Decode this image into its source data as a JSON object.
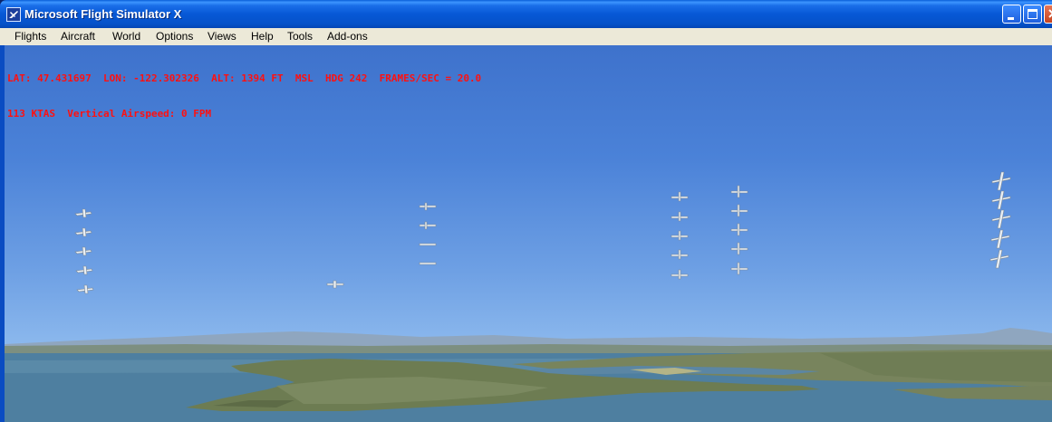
{
  "window": {
    "title": "Microsoft Flight Simulator X",
    "icon": "fsx-plane-icon",
    "controls": [
      "minimize",
      "maximize",
      "close"
    ]
  },
  "menubar": {
    "items": [
      {
        "label": "Flights"
      },
      {
        "label": "Aircraft"
      },
      {
        "label": "World"
      },
      {
        "label": "Options"
      },
      {
        "label": "Views"
      },
      {
        "label": "Help"
      },
      {
        "label": "Tools"
      },
      {
        "label": "Add-ons"
      }
    ]
  },
  "hud": {
    "line1": "LAT: 47.431697  LON: -122.302326  ALT: 1394 FT  MSL  HDG 242  FRAMES/SEC = 20.0",
    "line2": "113 KTAS  Vertical Airspeed: 0 FPM",
    "color": "#ff1010"
  },
  "scene": {
    "sky_top": "#3e72cc",
    "sky_horizon": "#a8cbf0",
    "water": "#4e7fa0",
    "land": "#6d7c52"
  }
}
